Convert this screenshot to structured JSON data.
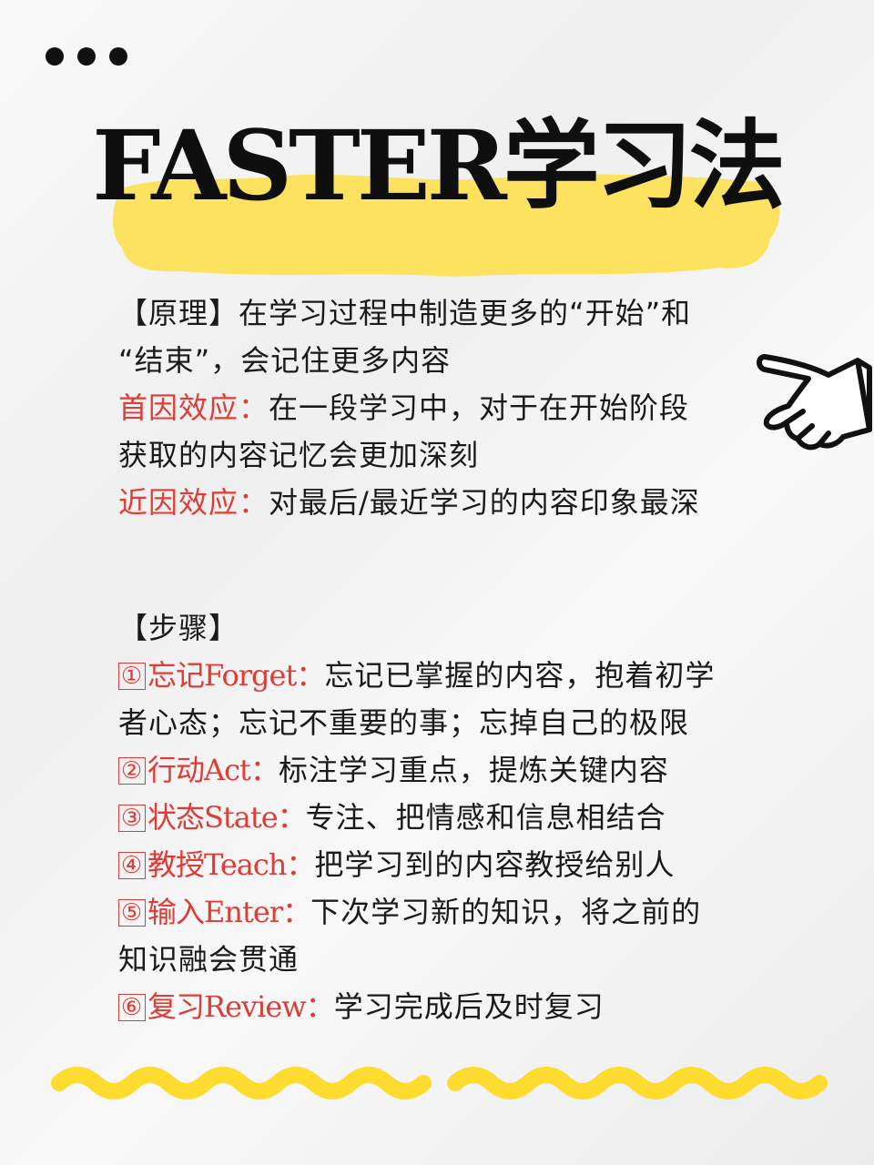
{
  "title": "FASTER学习法",
  "principle": {
    "label": "【原理】",
    "text_line1": "在学习过程中制造更多的“开始”和",
    "text_line2": "“结束”，会记住更多内容"
  },
  "primacy": {
    "label": "首因效应：",
    "text_line1": "在一段学习中，对于在开始阶段",
    "text_line2": "获取的内容记忆会更加深刻"
  },
  "recency": {
    "label": "近因效应：",
    "text": "对最后/最近学习的内容印象最深"
  },
  "steps_header": "【步骤】",
  "steps": [
    {
      "num": "①",
      "title": "忘记Forget：",
      "line1": "忘记已掌握的内容，抱着初学",
      "line2": "者心态；忘记不重要的事；忘掉自己的极限"
    },
    {
      "num": "②",
      "title": "行动Act：",
      "line1": "标注学习重点，提炼关键内容"
    },
    {
      "num": "③",
      "title": "状态State：",
      "line1": "专注、把情感和信息相结合"
    },
    {
      "num": "④",
      "title": "教授Teach：",
      "line1": "把学习到的内容教授给别人"
    },
    {
      "num": "⑤",
      "title": "输入Enter：",
      "line1": "下次学习新的知识，将之前的",
      "line2": "知识融会贯通"
    },
    {
      "num": "⑥",
      "title": "复习Review：",
      "line1": "学习完成后及时复习"
    }
  ],
  "decorations": {
    "highlight_color": "#fde260",
    "accent_red": "#e03b35",
    "squiggle_color": "#fddb2f",
    "icons": [
      "more-dots-icon",
      "pointing-hand-icon"
    ]
  }
}
